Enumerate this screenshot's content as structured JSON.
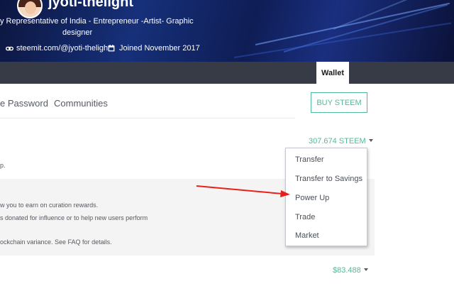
{
  "profile": {
    "username": "jyoti-thelight",
    "bio_line_1": "y Representative of India - Entrepreneur -Artist- Graphic",
    "bio_line_2": "designer",
    "link": "steemit.com/@jyoti-thelight",
    "joined": "Joined November 2017"
  },
  "nav": {
    "wallet_tab": "Wallet"
  },
  "subnav": {
    "password_partial": "e Password",
    "communities": "Communities"
  },
  "actions": {
    "buy_steem": "BUY STEEM"
  },
  "wallet": {
    "steem_balance": "307.674 STEEM",
    "steem_desc_partial": "p.",
    "sp_desc_line_1": "w you to earn on curation rewards.",
    "sp_desc_line_2": "s donated for influence or to help new users perform",
    "sp_desc_line_3": "ockchain variance. See FAQ for details.",
    "sbd_balance": "$83.488"
  },
  "dropdown": {
    "items": [
      "Transfer",
      "Transfer to Savings",
      "Power Up",
      "Trade",
      "Market"
    ]
  },
  "colors": {
    "accent": "#4fbb9a",
    "nav_dark": "#363b45",
    "annotation_arrow": "#e8201c"
  }
}
